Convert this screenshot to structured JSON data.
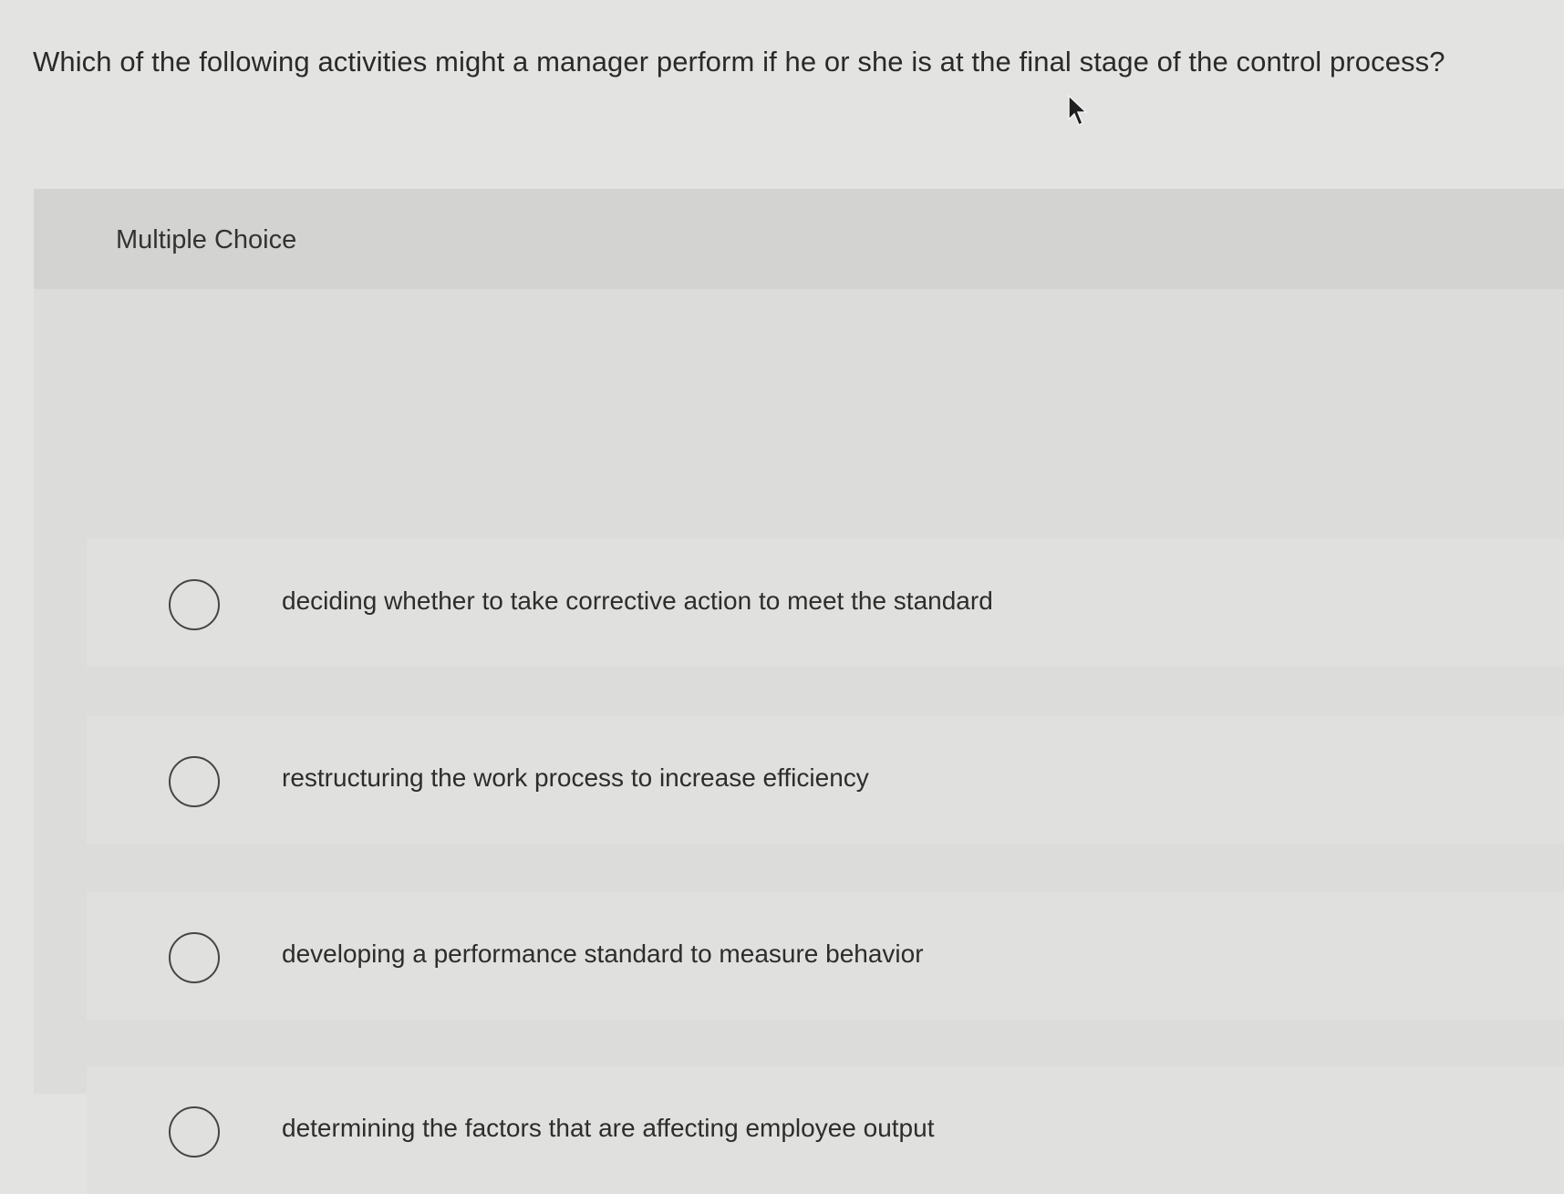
{
  "question": {
    "text": "Which of the following activities might a manager perform if he or she is at the final stage of the control process?"
  },
  "panel": {
    "title": "Multiple Choice"
  },
  "options": [
    {
      "label": "deciding whether to take corrective action to meet the standard",
      "selected": false
    },
    {
      "label": "restructuring the work process to increase efficiency",
      "selected": false
    },
    {
      "label": "developing a performance standard to measure behavior",
      "selected": false
    },
    {
      "label": "determining the factors that are affecting employee output",
      "selected": false
    }
  ],
  "icons": {
    "cursor": "mouse-pointer-icon",
    "radio": "radio-button-icon"
  }
}
